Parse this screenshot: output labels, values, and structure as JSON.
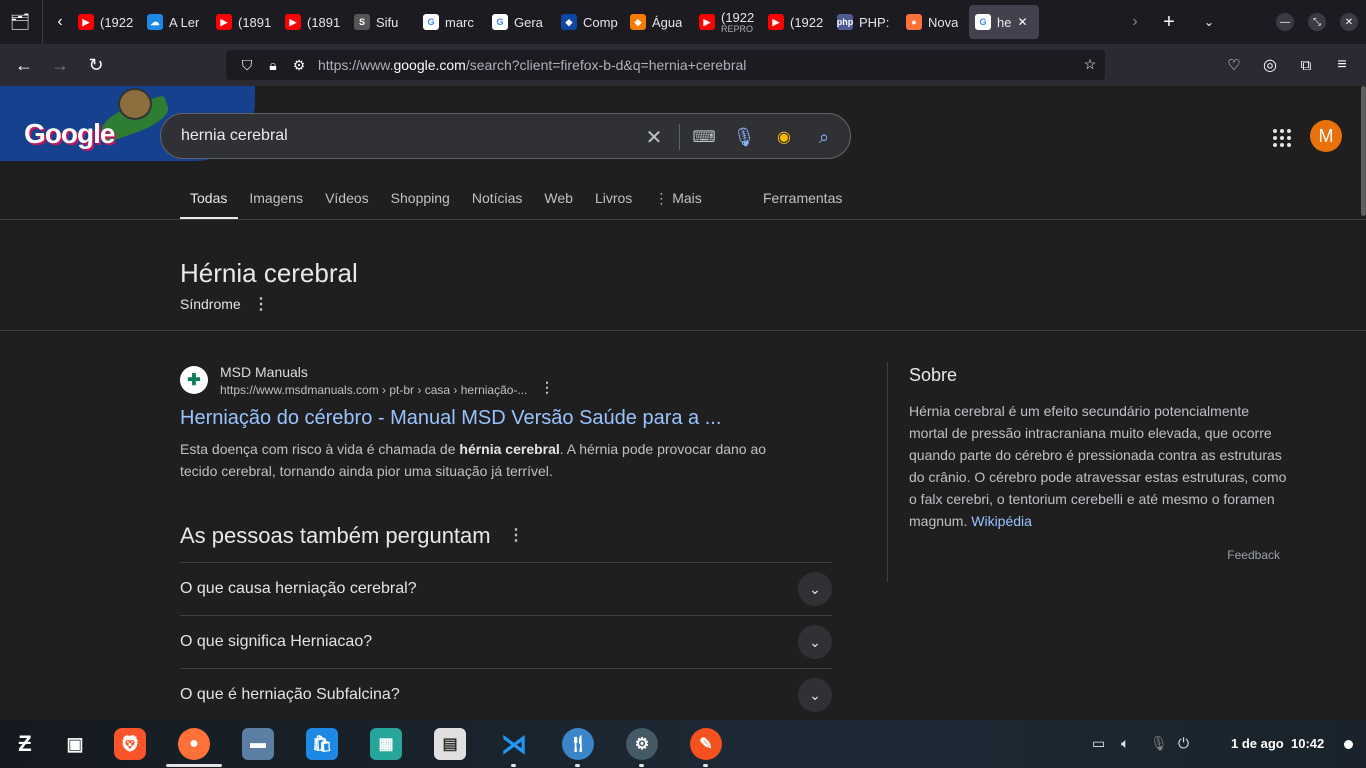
{
  "browser": {
    "tabs": [
      {
        "label": "(1922",
        "fav_color": "#ff0000",
        "fav_glyph": "▶"
      },
      {
        "label": "A Ler",
        "fav_color": "#1e88e5",
        "fav_glyph": "☁"
      },
      {
        "label": "(1891",
        "fav_color": "#ff0000",
        "fav_glyph": "▶"
      },
      {
        "label": "(1891",
        "fav_color": "#ff0000",
        "fav_glyph": "▶"
      },
      {
        "label": "Sifu",
        "fav_color": "#555555",
        "fav_glyph": "S"
      },
      {
        "label": "marc",
        "fav_color": "#ffffff",
        "fav_glyph": "G"
      },
      {
        "label": "Gera",
        "fav_color": "#ffffff",
        "fav_glyph": "G"
      },
      {
        "label": "Comp",
        "fav_color": "#0d47a1",
        "fav_glyph": "◆"
      },
      {
        "label": "Água",
        "fav_color": "#f57c00",
        "fav_glyph": "◆"
      },
      {
        "label": "(1922",
        "sub": "REPRO",
        "fav_color": "#ff0000",
        "fav_glyph": "▶"
      },
      {
        "label": "(1922",
        "fav_color": "#ff0000",
        "fav_glyph": "▶"
      },
      {
        "label": "PHP:",
        "fav_color": "#4f5b93",
        "fav_glyph": "php"
      },
      {
        "label": "Nova",
        "fav_color": "#ff7139",
        "fav_glyph": "●"
      },
      {
        "label": "he",
        "fav_color": "#ffffff",
        "fav_glyph": "G",
        "active": true
      }
    ],
    "url_prefix": "https://www.",
    "url_domain": "google.com",
    "url_path": "/search?client=firefox-b-d&q=hernia+cerebral"
  },
  "search": {
    "query": "hernia cerebral",
    "avatar_letter": "M",
    "tabs": [
      "Todas",
      "Imagens",
      "Vídeos",
      "Shopping",
      "Notícias",
      "Web",
      "Livros",
      "Mais"
    ],
    "tools_label": "Ferramentas"
  },
  "knowledge": {
    "title": "Hérnia cerebral",
    "subtitle": "Síndrome"
  },
  "result": {
    "site": "MSD Manuals",
    "url": "https://www.msdmanuals.com › pt-br › casa › herniação-...",
    "title": "Herniação do cérebro - Manual MSD Versão Saúde para a ...",
    "snippet_pre": "Esta doença com risco à vida é chamada de ",
    "snippet_bold": "hérnia cerebral",
    "snippet_post": ". A hérnia pode provocar dano ao tecido cerebral, tornando ainda pior uma situação já terrível."
  },
  "paa": {
    "title": "As pessoas também perguntam",
    "questions": [
      "O que causa herniação cerebral?",
      "O que significa Herniacao?",
      "O que é herniação Subfalcina?"
    ]
  },
  "side": {
    "title": "Sobre",
    "text": "Hérnia cerebral é um efeito secundário potencialmente mortal de pressão intracraniana muito elevada, que ocorre quando parte do cérebro é pressionada contra as estruturas do crânio. O cérebro pode atravessar estas estruturas, como o falx cerebri, o tentorium cerebelli e até mesmo o foramen magnum. ",
    "source": "Wikipédia",
    "feedback": "Feedback"
  },
  "taskbar": {
    "date": "1 de ago",
    "time": "10:42"
  }
}
